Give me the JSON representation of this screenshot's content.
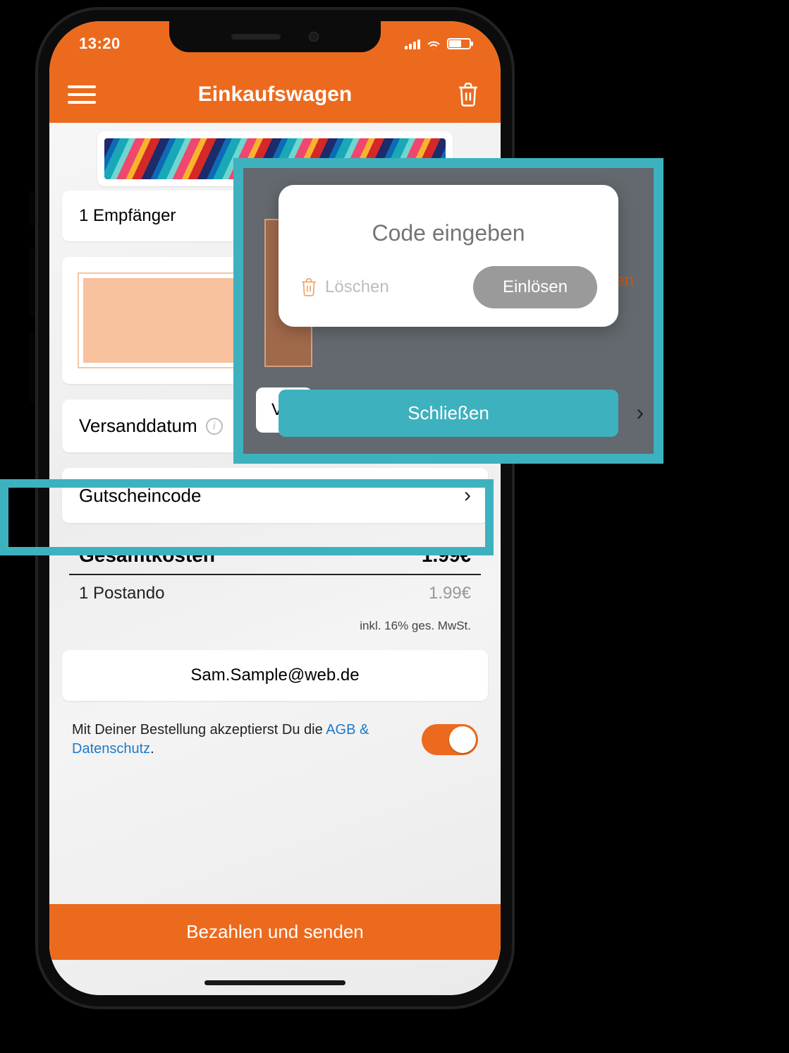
{
  "status": {
    "time": "13:20"
  },
  "header": {
    "title": "Einkaufswagen"
  },
  "recipients": {
    "label": "1 Empfänger"
  },
  "shipping": {
    "label": "Versanddatum"
  },
  "coupon": {
    "label": "Gutscheincode"
  },
  "totals": {
    "total_label": "Gesamtkosten",
    "total_value": "1.99€",
    "item_label": "1 Postando",
    "item_value": "1.99€",
    "vat": "inkl. 16% ges. MwSt."
  },
  "email": {
    "value": "Sam.Sample@web.de"
  },
  "terms": {
    "prefix": "Mit Deiner Bestellung akzeptierst Du die ",
    "link": "AGB & Datenschutz",
    "suffix": "."
  },
  "pay": {
    "label": "Bezahlen und senden"
  },
  "modal": {
    "placeholder": "Code eingeben",
    "delete": "Löschen",
    "redeem": "Einlösen",
    "close": "Schließen",
    "bg_frag1": "V",
    "bg_frag2": "en",
    "bg_frag_left": "Ve"
  },
  "colors": {
    "accent": "#ec6a1e",
    "teal": "#3eb1bf",
    "link": "#1d79c8"
  }
}
